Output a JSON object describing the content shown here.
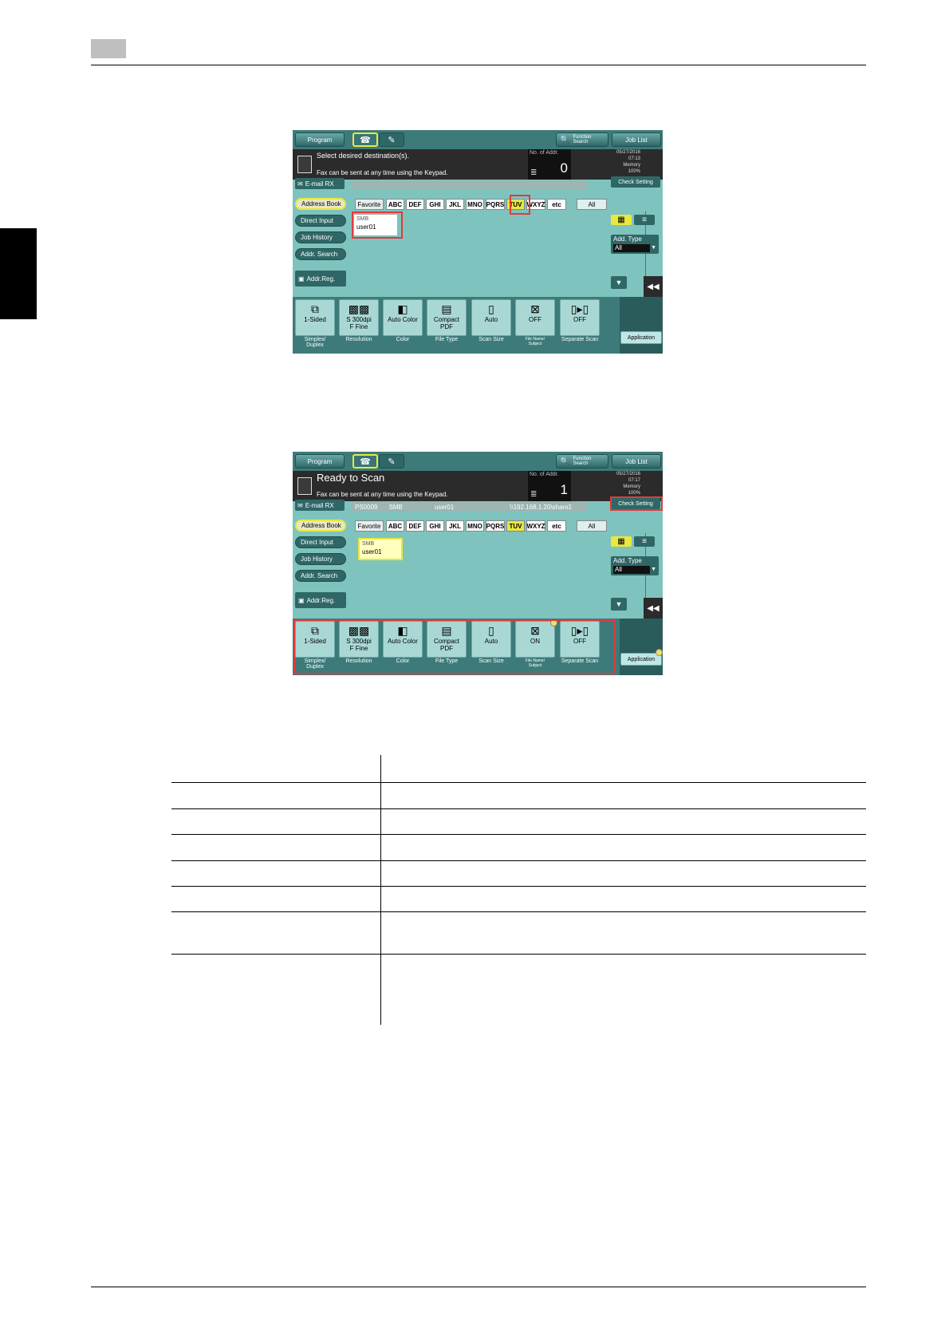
{
  "screen1": {
    "program": "Program",
    "search_label": "Function Search",
    "job_list": "Job List",
    "message1": "Select desired destination(s).",
    "message2": "Fax can be sent at any time using the Keypad.",
    "addr_label": "No. of Addr.",
    "addr_count": "0",
    "date": "05/27/2016",
    "time": "07:13",
    "memory_label": "Memory",
    "memory_value": "100%",
    "email_rx": "E-mail RX",
    "check_setting": "Check Setting",
    "nav": [
      "Address Book",
      "Direct Input",
      "Job History",
      "Addr. Search"
    ],
    "addr_reg": "Addr.Reg.",
    "alpha": [
      "Favorite",
      "ABC",
      "DEF",
      "GHI",
      "JKL",
      "MNO",
      "PQRS",
      "TUV",
      "WXYZ",
      "etc",
      "All"
    ],
    "card_type": "SMB",
    "card_name": "user01",
    "add_type_label": "Add. Type",
    "add_type_value": "All",
    "functions": [
      {
        "text1": "1-Sided",
        "text2": "",
        "label1": "Simplex/",
        "label2": "Duplex"
      },
      {
        "text1": "S 300dpi",
        "text2": "F Fine",
        "label1": "Resolution",
        "label2": ""
      },
      {
        "text1": "Auto Color",
        "text2": "",
        "label1": "Color",
        "label2": ""
      },
      {
        "text1": "Compact",
        "text2": "PDF",
        "label1": "File Type",
        "label2": ""
      },
      {
        "text1": "Auto",
        "text2": "",
        "label1": "Scan Size",
        "label2": ""
      },
      {
        "text1": "OFF",
        "text2": "",
        "label1": "File Name/",
        "label2": "Subject"
      },
      {
        "text1": "OFF",
        "text2": "",
        "label1": "Separate Scan",
        "label2": ""
      }
    ],
    "application": "Application"
  },
  "screen2": {
    "program": "Program",
    "search_label": "Function Search",
    "job_list": "Job List",
    "message1": "Ready to Scan",
    "message2": "Fax can be sent at any time using the Keypad.",
    "addr_label": "No. of Addr.",
    "addr_count": "1",
    "date": "05/27/2016",
    "time": "07:17",
    "memory_label": "Memory",
    "memory_value": "100%",
    "email_rx": "E-mail RX",
    "check_setting": "Check Setting",
    "dest_no": "PS0009",
    "dest_type": "SMB",
    "dest_name": "user01",
    "dest_path": "\\\\192.168.1.20\\share1",
    "nav": [
      "Address Book",
      "Direct Input",
      "Job History",
      "Addr. Search"
    ],
    "addr_reg": "Addr.Reg.",
    "alpha": [
      "Favorite",
      "ABC",
      "DEF",
      "GHI",
      "JKL",
      "MNO",
      "PQRS",
      "TUV",
      "WXYZ",
      "etc",
      "All"
    ],
    "card_type": "SMB",
    "card_name": "user01",
    "add_type_label": "Add. Type",
    "add_type_value": "All",
    "functions": [
      {
        "text1": "1-Sided",
        "text2": "",
        "label1": "Simplex/",
        "label2": "Duplex"
      },
      {
        "text1": "S 300dpi",
        "text2": "F Fine",
        "label1": "Resolution",
        "label2": ""
      },
      {
        "text1": "Auto Color",
        "text2": "",
        "label1": "Color",
        "label2": ""
      },
      {
        "text1": "Compact",
        "text2": "PDF",
        "label1": "File Type",
        "label2": ""
      },
      {
        "text1": "Auto",
        "text2": "",
        "label1": "Scan Size",
        "label2": ""
      },
      {
        "text1": "ON",
        "text2": "",
        "label1": "File Name/",
        "label2": "Subject"
      },
      {
        "text1": "OFF",
        "text2": "",
        "label1": "Separate Scan",
        "label2": ""
      }
    ],
    "application": "Application"
  },
  "colors": {
    "panel": "#7fc3be",
    "dark": "#3d7b7a",
    "highlight": "#e03a3a",
    "selected": "#e8e840"
  }
}
